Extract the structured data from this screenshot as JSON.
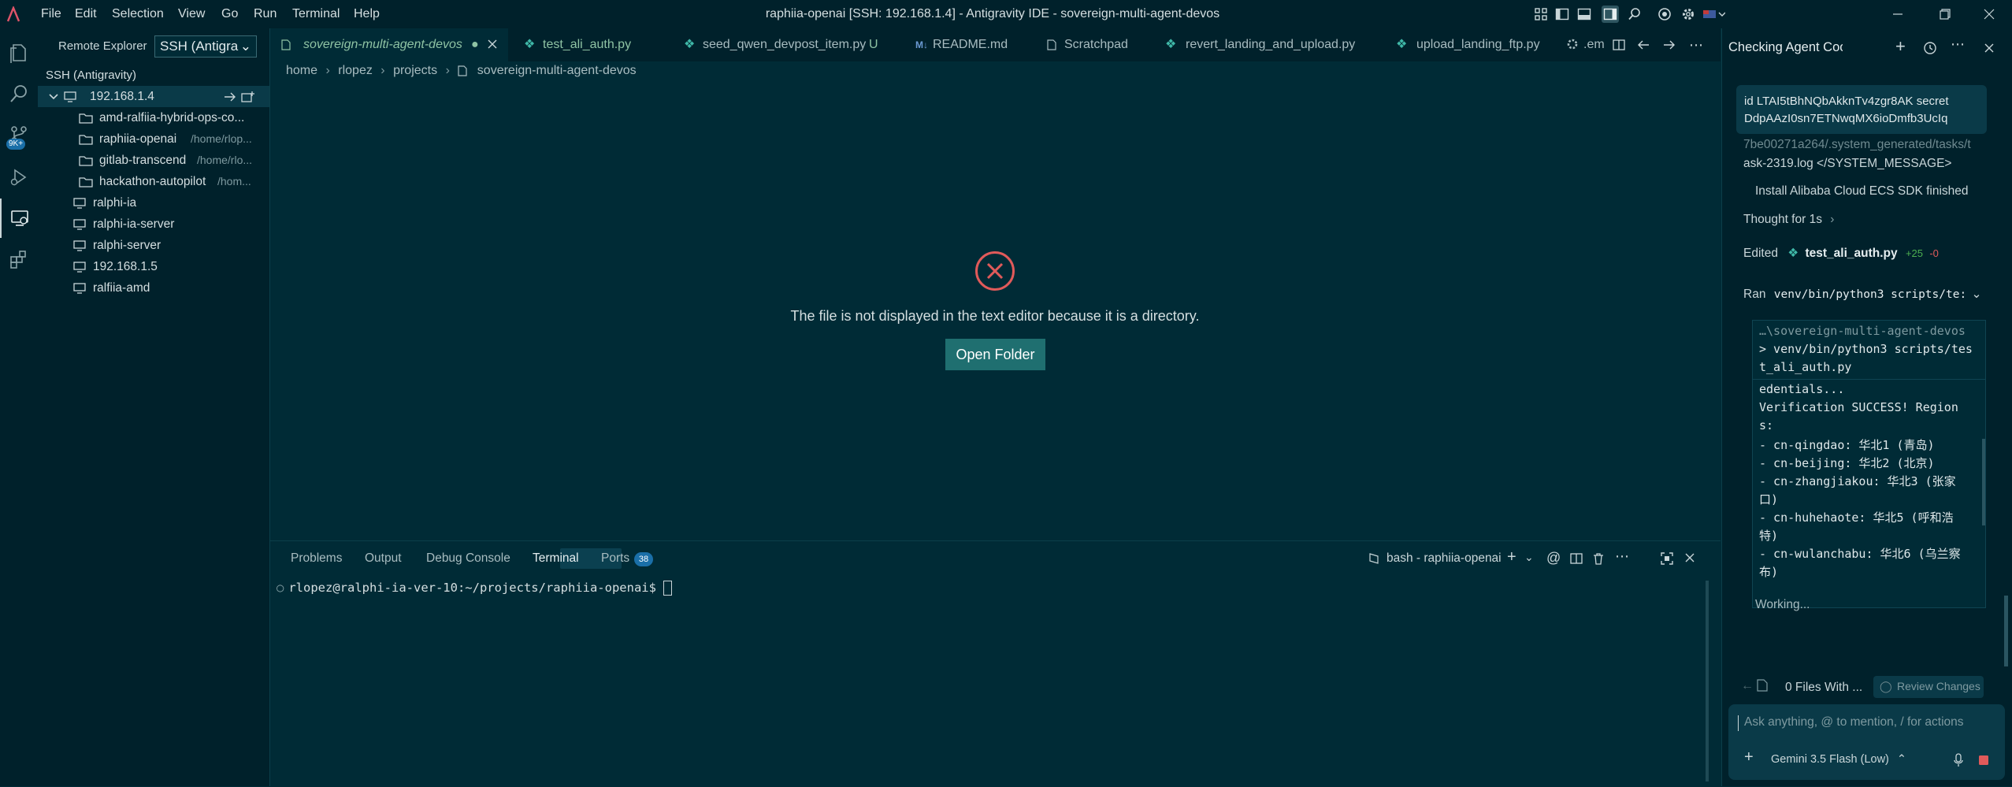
{
  "menu": [
    "File",
    "Edit",
    "Selection",
    "View",
    "Go",
    "Run",
    "Terminal",
    "Help"
  ],
  "window_title": "raphiia-openai [SSH: 192.168.1.4] - Antigravity IDE - sovereign-multi-agent-devos",
  "activity": {
    "badge": "9K+"
  },
  "sidebar": {
    "header": "Remote Explorer",
    "remote_select": "SSH (Antigra",
    "section": "SSH (Antigravity)",
    "host": "192.168.1.4",
    "folders": [
      {
        "name": "amd-ralfiia-hybrid-ops-co...",
        "desc": ""
      },
      {
        "name": "raphiia-openai",
        "desc": "/home/rlop..."
      },
      {
        "name": "gitlab-transcend",
        "desc": "/home/rlo..."
      },
      {
        "name": "hackathon-autopilot",
        "desc": "/hom..."
      }
    ],
    "hosts": [
      "ralphi-ia",
      "ralphi-ia-server",
      "ralphi-server",
      "192.168.1.5",
      "ralfiia-amd"
    ]
  },
  "tabs": [
    {
      "label": "sovereign-multi-agent-devos",
      "status": ""
    },
    {
      "label": "test_ali_auth.py",
      "status": "U"
    },
    {
      "label": "seed_qwen_devpost_item.py",
      "status": ""
    },
    {
      "label": "README.md",
      "status": ""
    },
    {
      "label": "Scratchpad",
      "status": ""
    },
    {
      "label": "revert_landing_and_upload.py",
      "status": ""
    },
    {
      "label": "upload_landing_ftp.py",
      "status": ""
    },
    {
      "label": ".em",
      "status": ""
    }
  ],
  "breadcrumb": [
    "home",
    "rlopez",
    "projects",
    "sovereign-multi-agent-devos"
  ],
  "editor": {
    "message": "The file is not displayed in the text editor because it is a directory.",
    "open_folder": "Open Folder"
  },
  "panel": {
    "tabs": [
      "Problems",
      "Output",
      "Debug Console",
      "Terminal",
      "Ports"
    ],
    "ports_count": "38",
    "terminal_name": "bash - raphiia-openai",
    "prompt": "rlopez@ralphi-ia-ver-10:~/projects/raphiia-openai$"
  },
  "agent": {
    "title": "Checking Agent Coordinat",
    "credentials_line1": "id LTAI5tBhNQbAkknTv4zgr8AK  secret",
    "credentials_line2": "DdpAAzI0sn7ETNwqMX6ioDmfb3UcIq",
    "path_fragment": "7be00271a264/.system_generated/tasks/t",
    "system_message": "ask-2319.log </SYSTEM_MESSAGE>",
    "install_status": "Install Alibaba Cloud ECS SDK finished",
    "thought": "Thought for 1s",
    "edited_label": "Edited",
    "edited_file": "test_ali_auth.py",
    "additions": "+25",
    "deletions": "-0",
    "ran_label": "Ran",
    "ran_command": "venv/bin/python3 scripts/te:",
    "code_lines": [
      "…\\sovereign-multi-agent-devos",
      "> venv/bin/python3 scripts/tes",
      "t_ali_auth.py",
      "edentials...",
      "Verification SUCCESS! Region",
      "s:",
      "- cn-qingdao: 华北1 (青岛)",
      "- cn-beijing: 华北2 (北京)",
      "- cn-zhangjiakou: 华北3 (张家",
      "口)",
      "- cn-huhehaote: 华北5 (呼和浩",
      "特)",
      "- cn-wulanchabu: 华北6 (乌兰察",
      "布)"
    ],
    "working": "Working...",
    "files_changed": "0 Files With ...",
    "review_changes": "Review Changes",
    "input_placeholder": "Ask anything, @ to mention, / for actions",
    "model": "Gemini 3.5 Flash (Low)"
  },
  "colors": {
    "accent": "#1f6f70",
    "error": "#e05a5a",
    "python": "#3fb8a8",
    "added": "#4caf50",
    "removed": "#e05a5a"
  }
}
